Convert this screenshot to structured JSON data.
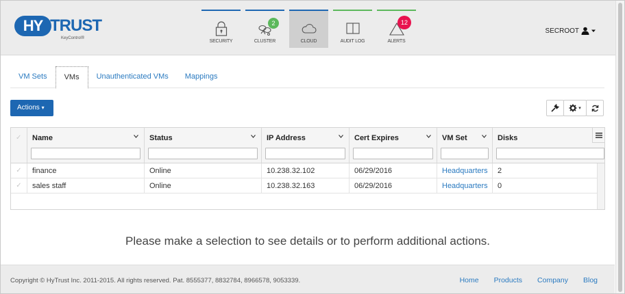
{
  "header": {
    "logo": {
      "hy": "HY",
      "trust": "TRUST",
      "subtitle": "KeyControl®"
    },
    "nav": [
      {
        "label": "SECURITY",
        "icon": "lock-icon",
        "bar_color": "#1d67b2",
        "badge": ""
      },
      {
        "label": "CLUSTER",
        "icon": "cluster-icon",
        "bar_color": "#1d67b2",
        "badge": "2",
        "badge_color": "#5cb85c"
      },
      {
        "label": "CLOUD",
        "icon": "cloud-icon",
        "bar_color": "#1d67b2",
        "badge": "",
        "active": true
      },
      {
        "label": "AUDIT LOG",
        "icon": "book-icon",
        "bar_color": "#5cb85c",
        "badge": ""
      },
      {
        "label": "ALERTS",
        "icon": "alert-icon",
        "bar_color": "#5cb85c",
        "badge": "12",
        "badge_color": "#e8134f"
      }
    ],
    "user": "SECROOT"
  },
  "tabs": [
    {
      "label": "VM Sets"
    },
    {
      "label": "VMs",
      "active": true
    },
    {
      "label": "Unauthenticated VMs"
    },
    {
      "label": "Mappings"
    }
  ],
  "toolbar": {
    "actions_label": "Actions"
  },
  "grid": {
    "columns": [
      {
        "label": "Name"
      },
      {
        "label": "Status"
      },
      {
        "label": "IP Address"
      },
      {
        "label": "Cert Expires"
      },
      {
        "label": "VM Set"
      },
      {
        "label": "Disks"
      }
    ],
    "rows": [
      {
        "name": "finance",
        "status": "Online",
        "ip": "10.238.32.102",
        "cert": "06/29/2016",
        "vmset": "Headquarters",
        "disks": "2"
      },
      {
        "name": "sales staff",
        "status": "Online",
        "ip": "10.238.32.163",
        "cert": "06/29/2016",
        "vmset": "Headquarters",
        "disks": "0"
      }
    ]
  },
  "message": "Please make a selection to see details or to perform additional actions.",
  "footer": {
    "copyright": "Copyright © HyTrust Inc. 2011-2015. All rights reserved. Pat. 8555377, 8832784, 8966578, 9053339.",
    "links": [
      "Home",
      "Products",
      "Company",
      "Blog"
    ]
  },
  "colors": {
    "accent": "#1d67b2",
    "link": "#2a7ac0",
    "success": "#5cb85c",
    "alert": "#e8134f"
  }
}
